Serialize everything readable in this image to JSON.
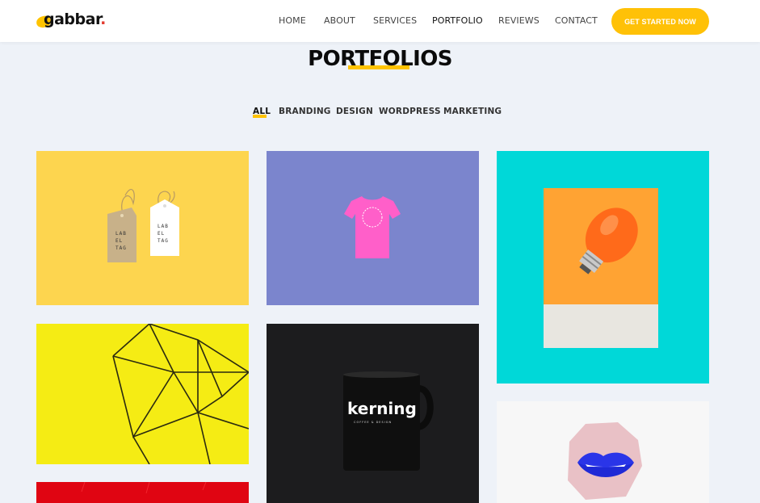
{
  "brand": {
    "name": "gabbar",
    "dot": "."
  },
  "nav": {
    "items": [
      "HOME",
      "ABOUT",
      "SERVICES",
      "PORTFOLIO",
      "REVIEWS",
      "CONTACT"
    ],
    "active": "PORTFOLIO",
    "cta_label": "GET STARTED NOW"
  },
  "section": {
    "title": "PORTFOLIOS"
  },
  "filters": {
    "items": [
      "ALL",
      "BRANDING",
      "DESIGN",
      "WORDPRESS",
      "MARKETING"
    ],
    "active": "ALL"
  },
  "portfolio": {
    "label_tag_lines": [
      "LAB",
      "EL",
      "TAG"
    ],
    "mug_brand": "kerning",
    "mug_tagline": "COFFEE & DESIGN"
  },
  "colors": {
    "accent": "#ffc107",
    "tile_label_tags_bg": "#fdd54f",
    "tile_tshirt_bg": "#7b85cd",
    "tile_bulb_bg": "#00d8d8",
    "tile_geometric_bg": "#f5ec14",
    "tile_mug_bg": "#1c1c1e",
    "tile_lips_bg": "#f7f7f7",
    "tile_red_bg": "#e00512"
  }
}
